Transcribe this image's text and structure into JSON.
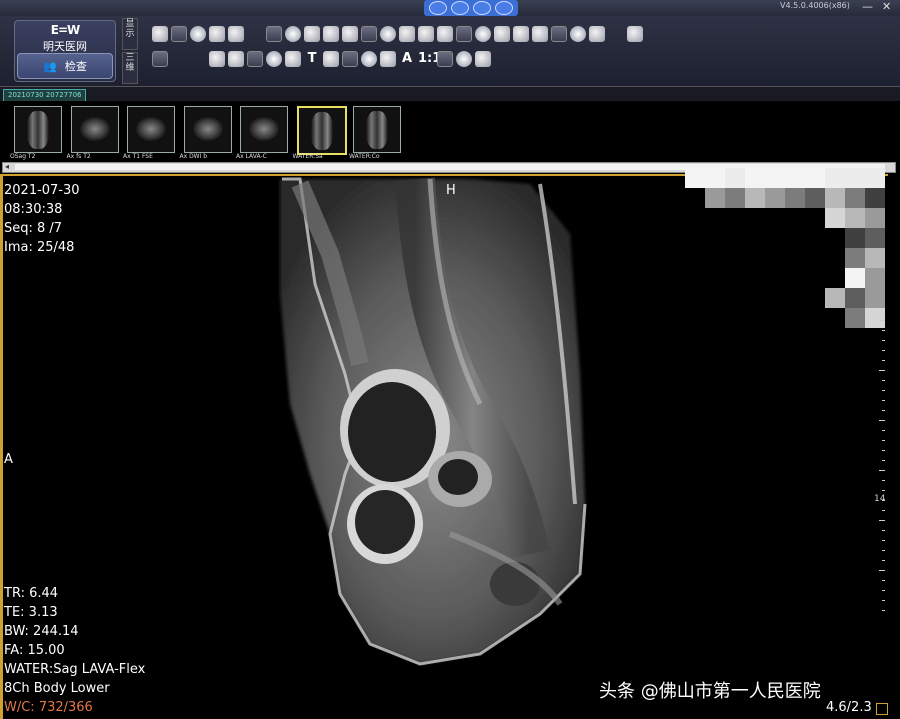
{
  "titlebar": {
    "version": "V4.5.0.4006(x86)",
    "minimize": "—",
    "close": "✕"
  },
  "brand": {
    "logo_mark": "E=W",
    "name": "明天医网",
    "check_button": "检查"
  },
  "side_tabs": [
    "显示",
    "三维"
  ],
  "toolbar_icons": [
    "wrench-icon",
    "monitor-icon",
    "folder-icon",
    "person-icon",
    "person-edit-icon",
    "sep",
    "grid-icon",
    "ra-icon",
    "sphere-icon",
    "magnify-box-icon",
    "split-icon",
    "split2-icon",
    "pencil-icon",
    "angle-icon",
    "ellipse-icon",
    "roi-icon",
    "arrow-icon",
    "dot-icon",
    "figure-icon",
    "image-icon",
    "cd-icon",
    "cursor-icon",
    "undo-icon",
    "download-icon",
    "sep",
    "save-icon",
    "floppy-icon",
    "sep",
    "sep",
    "pan-icon",
    "updown-icon",
    "zoom-icon",
    "window-icon",
    "flip-icon",
    "text-icon",
    "line-measure-icon",
    "angle2-icon",
    "ruler-icon",
    "freehand-icon",
    "text-a-icon",
    "scale-icon",
    "figure2-icon",
    "crosshair-icon",
    "circle-icon"
  ],
  "toolbar_text_icons": {
    "text-icon": "T",
    "text-a-icon": "A",
    "scale-icon": "1:1"
  },
  "study": {
    "tab_label": "20210730 20727706"
  },
  "series_thumbs": [
    {
      "label": "OSag T2",
      "kind": "sag"
    },
    {
      "label": "Ax fs T2",
      "kind": "ax"
    },
    {
      "label": "Ax T1 FSE",
      "kind": "ax"
    },
    {
      "label": "Ax DWI b",
      "kind": "ax"
    },
    {
      "label": "Ax LAVA-C",
      "kind": "ax"
    },
    {
      "label": "WATER:Sa",
      "kind": "sag",
      "selected": true
    },
    {
      "label": "WATER:Co",
      "kind": "sag"
    }
  ],
  "overlay_top_left": {
    "date": "2021-07-30",
    "time": "08:30:38",
    "seq": "Seq: 8 /7",
    "ima": "Ima: 25/48"
  },
  "orientation": {
    "top": "H",
    "left": "A"
  },
  "overlay_bottom_left": {
    "tr": "TR: 6.44",
    "te": "TE: 3.13",
    "bw": "BW: 244.14",
    "fa": "FA: 15.00",
    "series": "WATER:Sag LAVA-Flex",
    "coil": "8Ch Body Lower",
    "wc": "W/C: 732/366"
  },
  "overlay_bottom_right": {
    "zoom": "4.6/2.3"
  },
  "ruler_label": "14",
  "watermark": "头条 @佛山市第一人民医院",
  "colors": {
    "accent_frame": "#d0a030",
    "window_center": "#e07848",
    "selected_thumb": "#e8e060"
  }
}
